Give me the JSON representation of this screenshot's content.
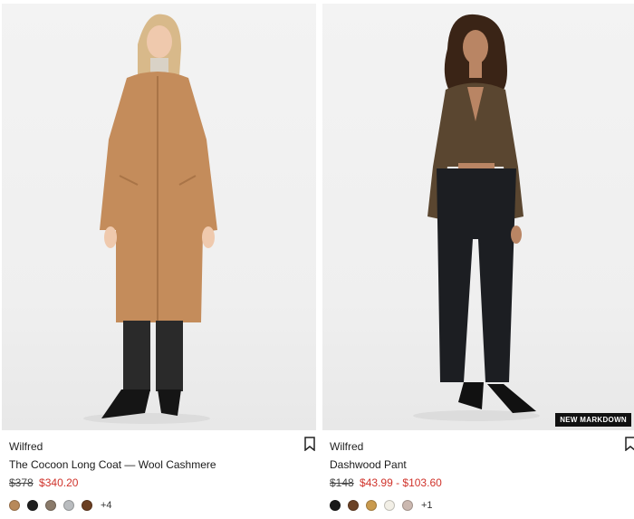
{
  "products": [
    {
      "brand": "Wilfred",
      "name": "The Cocoon Long Coat — Wool Cashmere",
      "original_price": "$378",
      "sale_price": "$340.20",
      "swatch_colors": [
        "#b8895a",
        "#1f1f1f",
        "#8a7a6a",
        "#b9bcbf",
        "#6b3f22"
      ],
      "more_colors": "+4",
      "image_icon": "model-in-camel-coat",
      "bookmark_icon": "bookmark-icon"
    },
    {
      "brand": "Wilfred",
      "name": "Dashwood Pant",
      "original_price": "$148",
      "sale_price": "$43.99 - $103.60",
      "badge": "NEW MARKDOWN",
      "swatch_colors": [
        "#1a1a1a",
        "#6b4226",
        "#c99a4e",
        "#f2efe6",
        "#cbb8b0"
      ],
      "more_colors": "+1",
      "image_icon": "model-in-black-pants",
      "bookmark_icon": "bookmark-icon"
    }
  ],
  "colors": {
    "sale": "#d0342c",
    "badge_bg": "#111111"
  }
}
